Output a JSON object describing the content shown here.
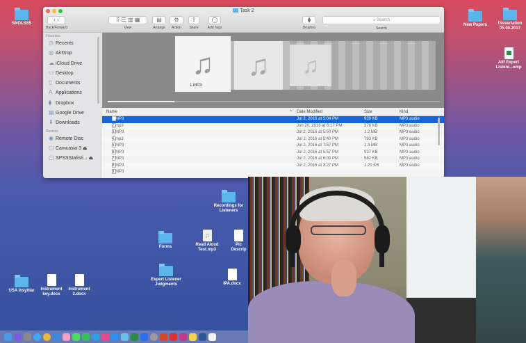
{
  "desktop": {
    "icons": [
      {
        "label": "SNOLSS5",
        "kind": "folder"
      },
      {
        "label": "New Papers",
        "kind": "folder"
      },
      {
        "label": "Dissertation 05.09.2017",
        "kind": "folder"
      },
      {
        "label": "Alif Expert Listeni...omp",
        "kind": "xls"
      },
      {
        "label": "Recordings for Listeners",
        "kind": "folder"
      },
      {
        "label": "Read Aloud Test.mp3",
        "kind": "audio"
      },
      {
        "label": "Pic Descrip",
        "kind": "doc"
      },
      {
        "label": "Forms",
        "kind": "folder"
      },
      {
        "label": "Expert Listener Judgments",
        "kind": "folder"
      },
      {
        "label": "IPA.docx",
        "kind": "doc"
      },
      {
        "label": "USA Insyitlar",
        "kind": "folder"
      },
      {
        "label": "Instrument key.docx",
        "kind": "doc"
      },
      {
        "label": "Instrument 2.docx",
        "kind": "doc"
      }
    ]
  },
  "finder": {
    "title": "Task 2",
    "toolbar": {
      "back_forward": "Back/Forward",
      "view": "View",
      "arrange": "Arrange",
      "action": "Action",
      "share": "Share",
      "add_tags": "Add Tags",
      "dropbox": "Dropbox",
      "search_placeholder": "Search",
      "search_caption": "Search"
    },
    "sidebar": {
      "favorites_header": "Favorites",
      "favorites": [
        {
          "label": "Recents",
          "icon": "clock-icon"
        },
        {
          "label": "AirDrop",
          "icon": "airdrop-icon"
        },
        {
          "label": "iCloud Drive",
          "icon": "cloud-icon"
        },
        {
          "label": "Desktop",
          "icon": "desktop-icon"
        },
        {
          "label": "Documents",
          "icon": "document-icon"
        },
        {
          "label": "Applications",
          "icon": "applications-icon"
        },
        {
          "label": "Dropbox",
          "icon": "dropbox-icon"
        },
        {
          "label": "Google Drive",
          "icon": "google-drive-icon"
        },
        {
          "label": "Downloads",
          "icon": "downloads-icon"
        }
      ],
      "devices_header": "Devices",
      "devices": [
        {
          "label": "Remote Disc",
          "icon": "disc-icon"
        },
        {
          "label": "Camcasia 3",
          "icon": "drive-icon"
        },
        {
          "label": "SPSSStatisti...",
          "icon": "drive-icon"
        }
      ]
    },
    "preview": {
      "selected_label": "1.MP3",
      "playback_progress": 0.2
    },
    "list": {
      "columns": [
        "Name",
        "Date Modified",
        "Size",
        "Kind"
      ],
      "rows": [
        {
          "name": "1.MP3",
          "date": "Jul 2, 2016 at 5:04 PM",
          "size": "939 KB",
          "kind": "MP3 audio",
          "selected": true
        },
        {
          "name": "2.mp3",
          "date": "Jun 20, 2016 at 6:17 PM",
          "size": "376 KB",
          "kind": "MP3 audio"
        },
        {
          "name": "3.MP3",
          "date": "Jul 2, 2016 at 5:50 PM",
          "size": "1.2 MB",
          "kind": "MP3 audio"
        },
        {
          "name": "4.mp3",
          "date": "Jul 2, 2016 at 5:40 PM",
          "size": "793 KB",
          "kind": "MP3 audio"
        },
        {
          "name": "5.MP3",
          "date": "Jul 2, 2016 at 7:57 PM",
          "size": "1.3 MB",
          "kind": "MP3 audio"
        },
        {
          "name": "6.MP3",
          "date": "Jul 2, 2016 at 5:57 PM",
          "size": "937 KB",
          "kind": "MP3 audio"
        },
        {
          "name": "7.MP3",
          "date": "Jul 2, 2016 at 6:00 PM",
          "size": "582 KB",
          "kind": "MP3 audio"
        },
        {
          "name": "8.MP3",
          "date": "Jul 2, 2016 at 3:27 PM",
          "size": "1.21 KB",
          "kind": "MP3 audio"
        },
        {
          "name": "9.MP3",
          "date": "",
          "size": "",
          "kind": ""
        }
      ]
    }
  },
  "colors": {
    "selection": "#1465d8",
    "folder": "#5ab5ea",
    "close": "#fc5f57",
    "minimize": "#fdbb2e",
    "zoom": "#28c840"
  }
}
